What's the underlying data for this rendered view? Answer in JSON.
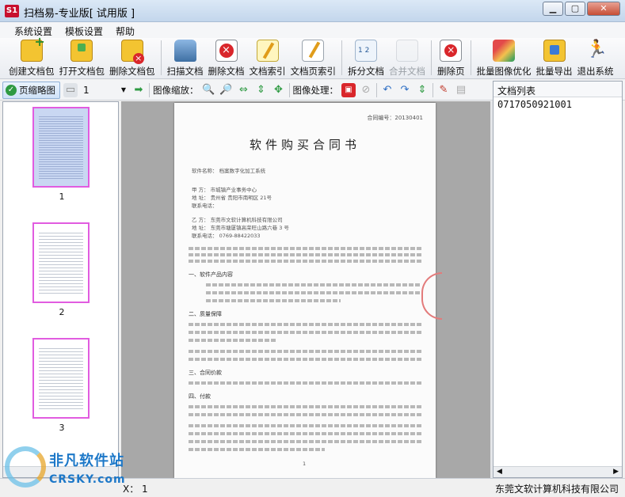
{
  "window": {
    "title": "扫档易-专业版[ 试用版 ]",
    "logo": "S1",
    "min": "▁",
    "max": "▢",
    "close": "✕"
  },
  "menu": [
    "系统设置",
    "模板设置",
    "帮助"
  ],
  "toolbar": {
    "buttons": [
      {
        "label": "创建文档包",
        "icon": "folder-new-icon",
        "enabled": true
      },
      {
        "label": "打开文档包",
        "icon": "folder-open-icon",
        "enabled": true
      },
      {
        "label": "删除文档包",
        "icon": "folder-delete-icon",
        "enabled": true
      },
      {
        "label": "扫描文档",
        "icon": "scanner-icon",
        "enabled": true
      },
      {
        "label": "删除文档",
        "icon": "document-delete-icon",
        "enabled": true
      },
      {
        "label": "文档索引",
        "icon": "document-index-icon",
        "enabled": true
      },
      {
        "label": "文档页索引",
        "icon": "page-index-icon",
        "enabled": true
      },
      {
        "label": "拆分文档",
        "icon": "split-document-icon",
        "enabled": true
      },
      {
        "label": "合并文档",
        "icon": "merge-document-icon",
        "enabled": false
      },
      {
        "label": "删除页",
        "icon": "page-delete-icon",
        "enabled": true
      },
      {
        "label": "批量图像优化",
        "icon": "image-optimize-icon",
        "enabled": true
      },
      {
        "label": "批量导出",
        "icon": "export-icon",
        "enabled": true
      },
      {
        "label": "退出系统",
        "icon": "exit-icon",
        "enabled": true
      }
    ]
  },
  "toolbar2": {
    "thumbnail_button": "页缩略图",
    "page_number": "1",
    "zoom_label": "图像缩放：",
    "process_label": "图像处理："
  },
  "thumbnails": [
    {
      "number": "1",
      "selected": true
    },
    {
      "number": "2",
      "selected": false
    },
    {
      "number": "3",
      "selected": false
    }
  ],
  "document": {
    "contract_no": "合同编号：20130401",
    "title": "软件购买合同书",
    "software_name": "软件名称：  档案数字化加工系统",
    "party_a": "甲    方：        市城镇产业事务中心",
    "address_a": "地    址：  贵州省        贵阳市南明区 21号",
    "phone_a": "联系电话：",
    "party_b": "乙    方：  东莞市文软计算机科技有限公司",
    "address_b": "地    址：  东莞市塘厦镇高荣旺山路六巷 3 号",
    "phone_b": "联系电话：  0769-88422033",
    "headings": [
      "一、软件产品内容",
      "二、质量保障",
      "三、合同价款",
      "四、付款"
    ],
    "page_number": "1"
  },
  "right_panel": {
    "header": "文档列表",
    "items": [
      "0717050921001"
    ]
  },
  "status": {
    "left": "X：  1",
    "company": "东莞文软计算机科技有限公司"
  },
  "watermark": {
    "text1": "非凡软件站",
    "text2": "CRSKY.com"
  }
}
